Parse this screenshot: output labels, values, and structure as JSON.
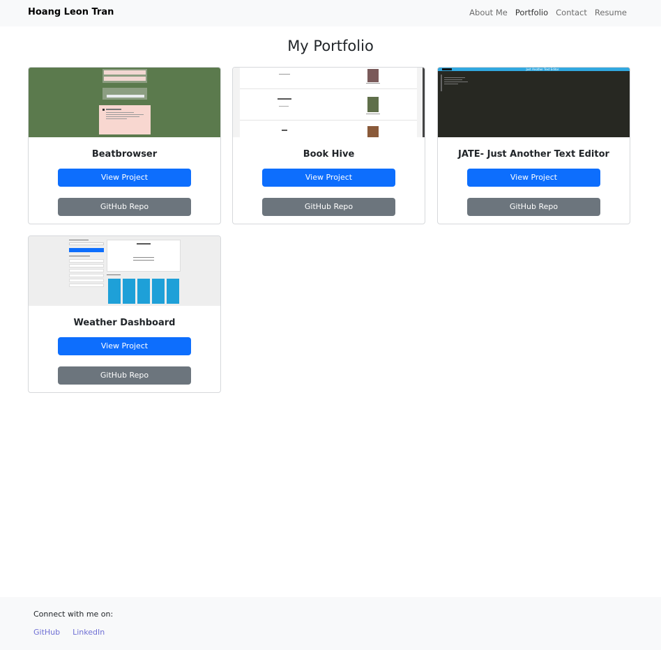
{
  "nav": {
    "brand": "Hoang Leon Tran",
    "links": [
      "About Me",
      "Portfolio",
      "Contact",
      "Resume"
    ]
  },
  "page": {
    "title": "My Portfolio"
  },
  "projects": [
    {
      "title": "Beatbrowser",
      "view_label": "View Project",
      "repo_label": "GitHub Repo",
      "thumb_label": ""
    },
    {
      "title": "Book Hive",
      "view_label": "View Project",
      "repo_label": "GitHub Repo",
      "thumb_label": ""
    },
    {
      "title": "JATE- Just Another Text Editor",
      "view_label": "View Project",
      "repo_label": "GitHub Repo",
      "thumb_label": "Just Another Text Editor"
    },
    {
      "title": "Weather Dashboard",
      "view_label": "View Project",
      "repo_label": "GitHub Repo",
      "thumb_label": ""
    }
  ],
  "footer": {
    "connect_text": "Connect with me on:",
    "links": [
      "GitHub",
      "LinkedIn"
    ]
  },
  "colors": {
    "primary": "#0d6efd",
    "secondary": "#6c757d",
    "navbar_bg": "#f8f9fa",
    "footer_link": "#6f6fd4"
  }
}
